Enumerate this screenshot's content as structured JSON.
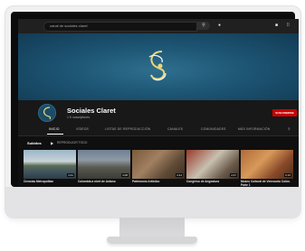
{
  "topbar": {
    "search_text": "canal de sociales claret",
    "search_icon": "search-icon",
    "mic_icon": "microphone-icon",
    "create_icon": "video-camera-icon",
    "apps_icon": "grid-icon"
  },
  "channel": {
    "name": "Sociales Claret",
    "subscribers": "1 K suscriptores",
    "subscribe_label": "SUSCRIBIRSE"
  },
  "tabs": [
    {
      "label": "INICIO",
      "active": true
    },
    {
      "label": "VÍDEOS",
      "active": false
    },
    {
      "label": "LISTAS DE REPRODUCCIÓN",
      "active": false
    },
    {
      "label": "CANALES",
      "active": false
    },
    {
      "label": "COMUNIDADES",
      "active": false
    },
    {
      "label": "MÁS INFORMACIÓN",
      "active": false
    }
  ],
  "section": {
    "title": "Subidos",
    "play_all": "REPRODUCIR TODO"
  },
  "videos": [
    {
      "title": "Ciencias Metropolitan",
      "duration": "4:31"
    },
    {
      "title": "Colombia a nivel de Antano",
      "duration": "3:08"
    },
    {
      "title": "Patrimonio Artistico",
      "duration": "3:44"
    },
    {
      "title": "Congreso de Angostura",
      "duration": "4:37"
    },
    {
      "title": "Museo Cultural de Venezuela Colón. Parte 1",
      "duration": "6:15"
    }
  ],
  "colors": {
    "subscribe": "#cc0000",
    "banner": "#1d5574",
    "background": "#0f0f0f"
  }
}
